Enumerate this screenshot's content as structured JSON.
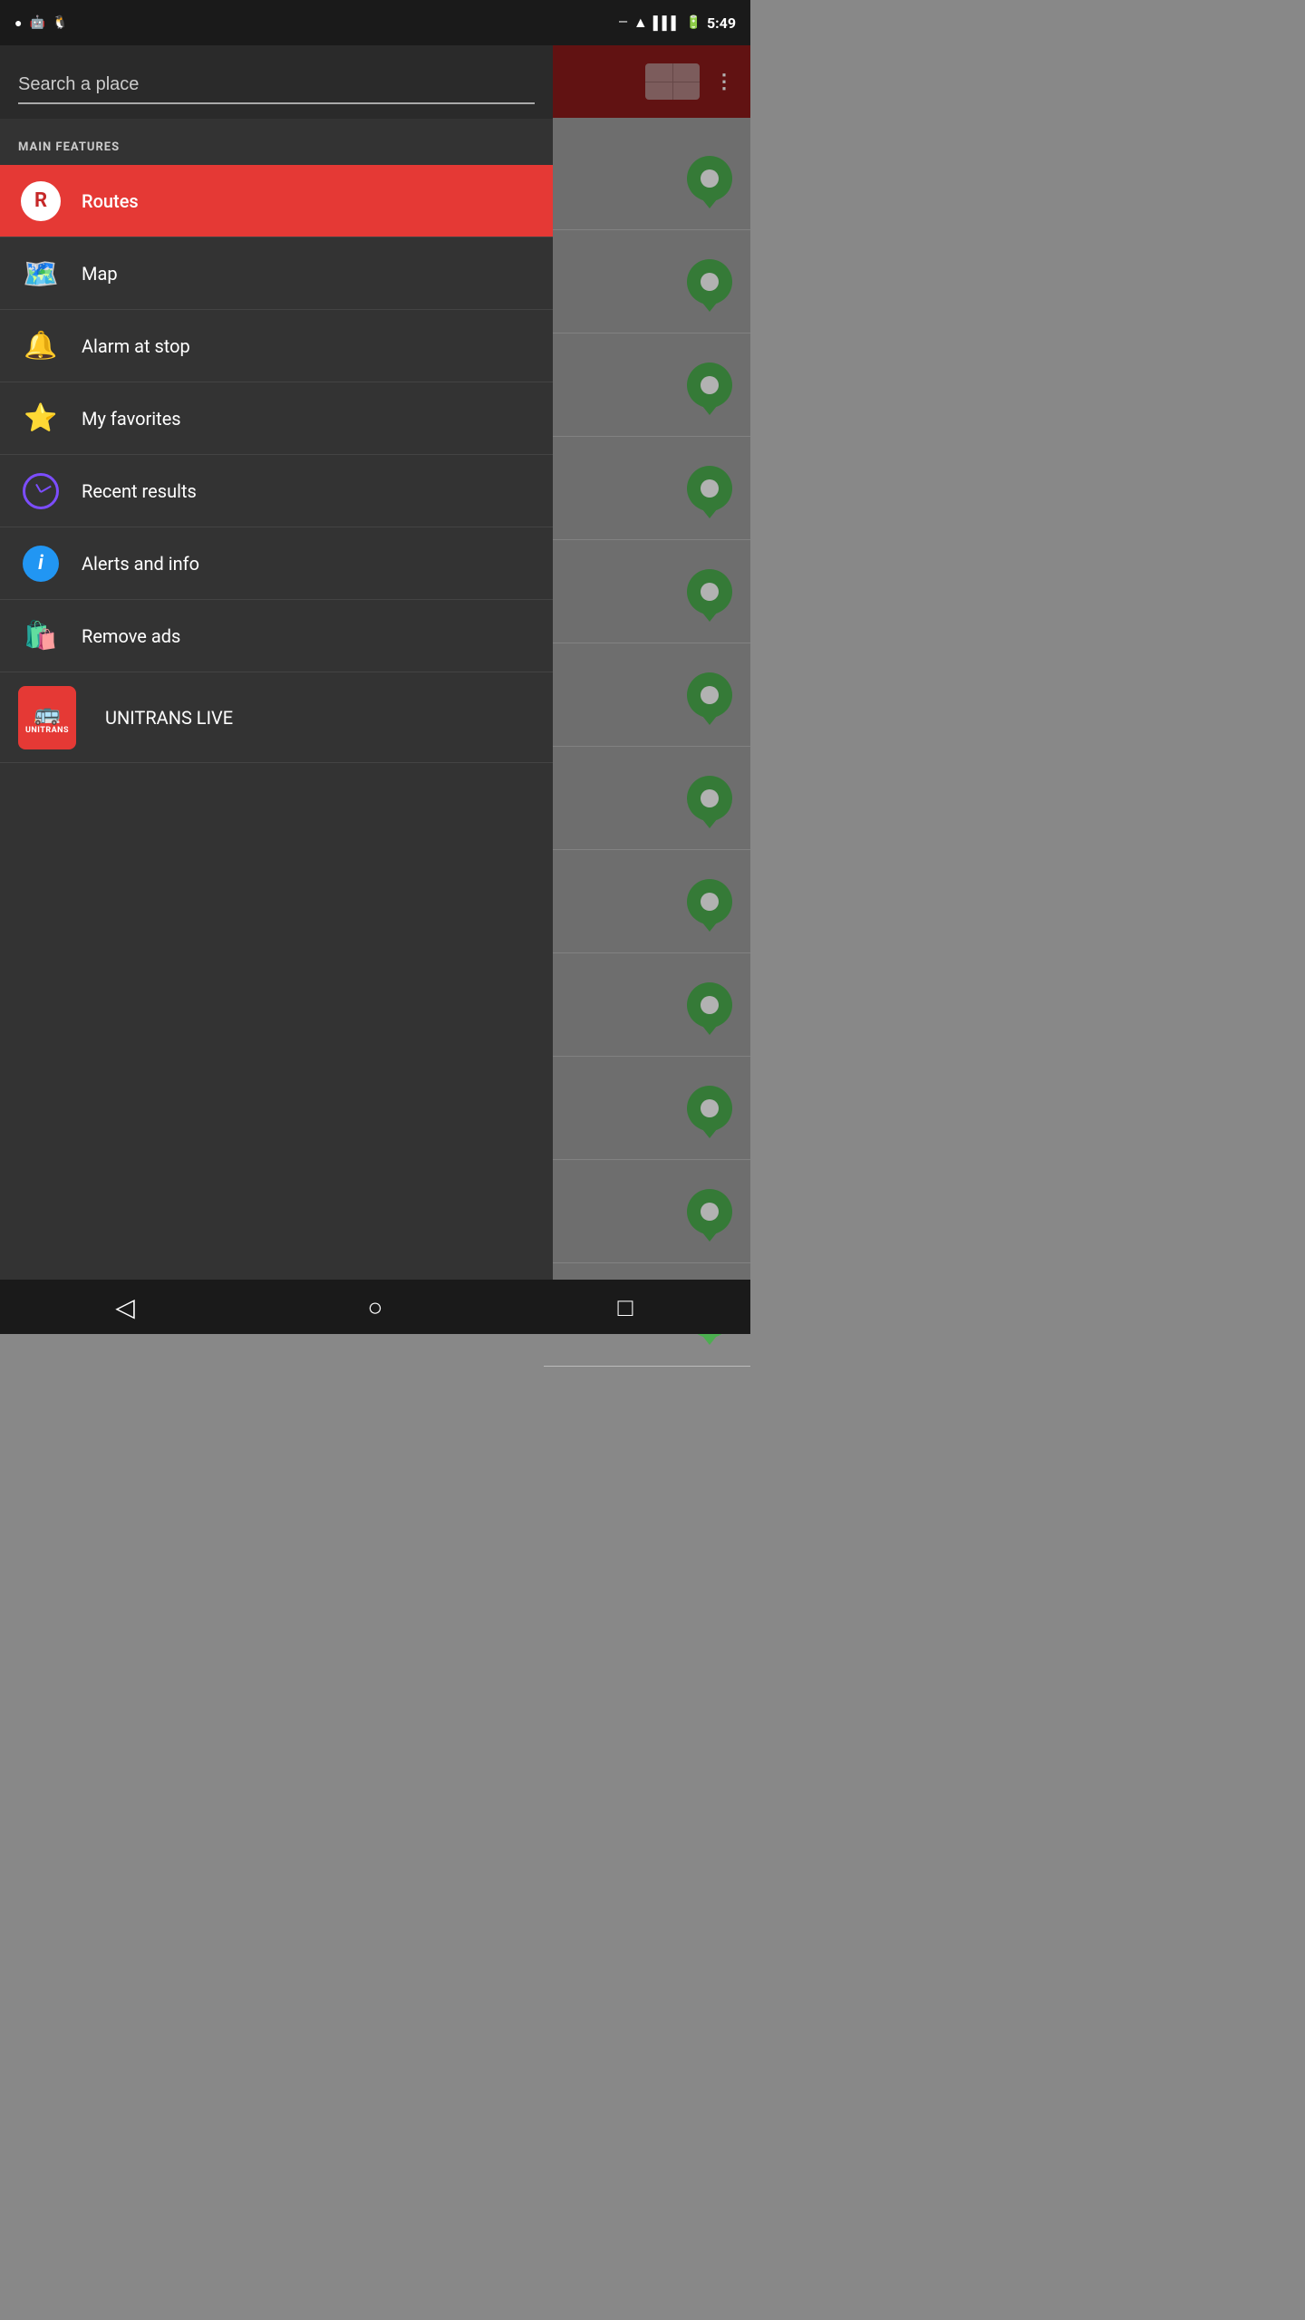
{
  "statusBar": {
    "time": "5:49",
    "icons": [
      "signal",
      "wifi",
      "battery"
    ]
  },
  "header": {
    "threeDotsLabel": "⋮"
  },
  "search": {
    "placeholder": "Search a place"
  },
  "mainFeatures": {
    "sectionLabel": "MAIN FEATURES"
  },
  "menuItems": [
    {
      "id": "routes",
      "label": "Routes",
      "iconType": "routes",
      "active": true
    },
    {
      "id": "map",
      "label": "Map",
      "iconType": "map",
      "active": false
    },
    {
      "id": "alarm",
      "label": "Alarm at stop",
      "iconType": "alarm",
      "active": false
    },
    {
      "id": "favorites",
      "label": "My favorites",
      "iconType": "star",
      "active": false
    },
    {
      "id": "recent",
      "label": "Recent results",
      "iconType": "clock",
      "active": false
    },
    {
      "id": "alerts",
      "label": "Alerts and info",
      "iconType": "info",
      "active": false
    },
    {
      "id": "removeads",
      "label": "Remove ads",
      "iconType": "bag",
      "active": false
    },
    {
      "id": "unitrans",
      "label": "UNITRANS LIVE",
      "iconType": "unitrans",
      "active": false
    }
  ],
  "mapPins": [
    {
      "id": 1
    },
    {
      "id": 2
    },
    {
      "id": 3
    },
    {
      "id": 4
    },
    {
      "id": 5
    },
    {
      "id": 6
    },
    {
      "id": 7
    },
    {
      "id": 8
    },
    {
      "id": 9
    },
    {
      "id": 10
    },
    {
      "id": 11
    },
    {
      "id": 12
    }
  ],
  "bottomNav": {
    "backLabel": "◁",
    "homeLabel": "○",
    "recentLabel": "□"
  }
}
